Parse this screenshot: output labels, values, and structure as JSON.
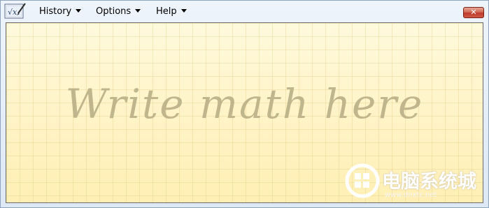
{
  "menubar": {
    "history_label": "History",
    "options_label": "Options",
    "help_label": "Help"
  },
  "window_controls": {
    "close_label": "✕"
  },
  "canvas": {
    "placeholder": "Write math here"
  },
  "watermark": {
    "text": "电脑系统城",
    "url": "www.dnxtc.net"
  },
  "colors": {
    "canvas_bg": "#fff2c0",
    "placeholder": "#bdb38a",
    "close_button": "#c0392b"
  },
  "icons": {
    "app": "math-input-icon",
    "watermark": "windows-logo-icon"
  }
}
